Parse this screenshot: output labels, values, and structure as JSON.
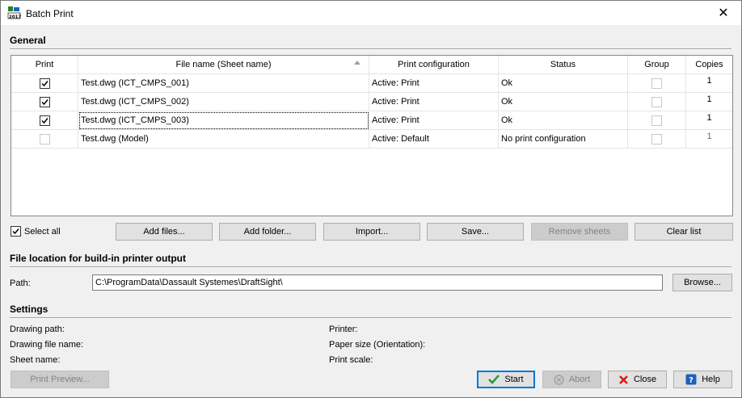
{
  "window": {
    "title": "Batch Print",
    "close_glyph": "✕"
  },
  "general": {
    "title": "General",
    "columns": [
      "Print",
      "File name (Sheet name)",
      "Print configuration",
      "Status",
      "Group",
      "Copies"
    ],
    "rows": [
      {
        "print": true,
        "file": "Test.dwg (ICT_CMPS_001)",
        "config": "Active: Print",
        "status": "Ok",
        "group": false,
        "copies": "1"
      },
      {
        "print": true,
        "file": "Test.dwg (ICT_CMPS_002)",
        "config": "Active: Print",
        "status": "Ok",
        "group": false,
        "copies": "1"
      },
      {
        "print": true,
        "file": "Test.dwg (ICT_CMPS_003)",
        "config": "Active: Print",
        "status": "Ok",
        "group": false,
        "copies": "1"
      },
      {
        "print": false,
        "file": "Test.dwg (Model)",
        "config": "Active: Default",
        "status": "No print configuration",
        "group": false,
        "copies": "1"
      }
    ],
    "select_all_label": "Select all",
    "buttons": {
      "add_files": "Add files...",
      "add_folder": "Add folder...",
      "import": "Import...",
      "save": "Save...",
      "remove_sheets": "Remove sheets",
      "clear_list": "Clear list"
    }
  },
  "file_location": {
    "title": "File location for build-in printer output",
    "path_label": "Path:",
    "path_value": "C:\\ProgramData\\Dassault Systemes\\DraftSight\\",
    "browse": "Browse..."
  },
  "settings": {
    "title": "Settings",
    "drawing_path": "Drawing path:",
    "drawing_file_name": "Drawing file name:",
    "sheet_name": "Sheet name:",
    "printer": "Printer:",
    "paper_size": "Paper size (Orientation):",
    "print_scale": "Print scale:"
  },
  "footer": {
    "print_preview": "Print Preview...",
    "start": "Start",
    "abort": "Abort",
    "close": "Close",
    "help": "Help"
  },
  "colors": {
    "accent": "#0078d7",
    "check_green": "#2b9a3b",
    "close_red": "#d71a1a"
  }
}
